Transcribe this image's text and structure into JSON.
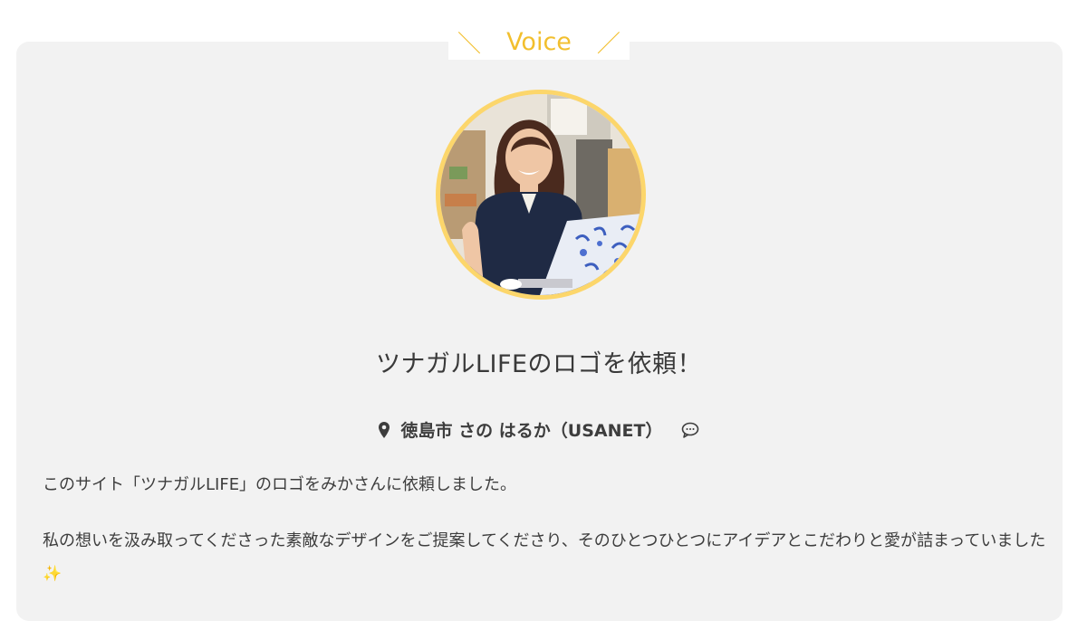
{
  "section": {
    "heading": "Voice",
    "slash_left": "＼",
    "slash_right": "／"
  },
  "testimonial": {
    "title": "ツナガルLIFEのロゴを依頼！",
    "location": "徳島市",
    "author": "さの はるか（USANET）",
    "paragraphs": [
      "このサイト「ツナガルLIFE」のロゴをみかさんに依頼しました。",
      "私の想いを汲み取ってくださった素敵なデザインをご提案してくださり、そのひとつひとつにアイデアとこだわりと愛が詰まっていました"
    ],
    "sparkle": "✨"
  },
  "icons": {
    "location": "map-pin-icon",
    "comment": "speech-bubble-icon"
  },
  "colors": {
    "accent": "#f2bf2e",
    "avatar_ring": "#fcd66b",
    "card_background": "#f2f2f2",
    "text": "#3d3d3d"
  }
}
